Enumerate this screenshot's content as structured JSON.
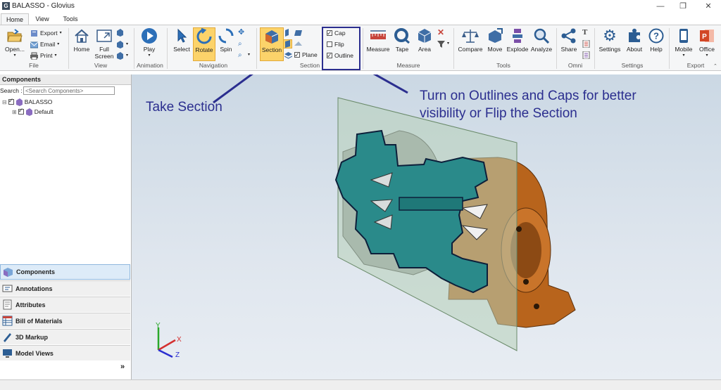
{
  "window": {
    "title": "BALASSO - Glovius",
    "app_icon_letter": "G"
  },
  "tabs": [
    {
      "label": "Home"
    },
    {
      "label": "View"
    },
    {
      "label": "Tools"
    }
  ],
  "ribbon": {
    "file": {
      "open": "Open...",
      "export": "Export",
      "email": "Email",
      "print": "Print",
      "group": "File"
    },
    "view": {
      "home": "Home",
      "fullscreen_1": "Full",
      "fullscreen_2": "Screen",
      "group": "View"
    },
    "animation": {
      "play": "Play",
      "group": "Animation"
    },
    "navigation": {
      "select": "Select",
      "rotate": "Rotate",
      "spin": "Spin",
      "group": "Navigation"
    },
    "section": {
      "section": "Section",
      "plane": "Plane",
      "group": "Section"
    },
    "options": {
      "cap": "Cap",
      "flip": "Flip",
      "outline": "Outline",
      "cap_checked": true,
      "flip_checked": false,
      "outline_checked": true
    },
    "measure": {
      "measure": "Measure",
      "tape": "Tape",
      "area": "Area",
      "group": "Measure"
    },
    "tools": {
      "compare": "Compare",
      "move": "Move",
      "explode": "Explode",
      "analyze": "Analyze",
      "group": "Tools"
    },
    "omni": {
      "share": "Share",
      "group": "Omni"
    },
    "settings": {
      "settings": "Settings",
      "about": "About",
      "help": "Help",
      "group": "Settings"
    },
    "export": {
      "mobile": "Mobile",
      "office": "Office",
      "group": "Export"
    }
  },
  "left_panel": {
    "header": "Components",
    "search_label": "Search :",
    "search_placeholder": "<Search Components>",
    "tree": [
      {
        "label": "BALASSO"
      },
      {
        "label": "Default"
      }
    ],
    "tabs": [
      {
        "label": "Components"
      },
      {
        "label": "Annotations"
      },
      {
        "label": "Attributes"
      },
      {
        "label": "Bill of Materials"
      },
      {
        "label": "3D Markup"
      },
      {
        "label": "Model Views"
      }
    ],
    "more": "»"
  },
  "annotations": {
    "take_section": "Take Section",
    "outline_line1": "Turn on Outlines and Caps for better",
    "outline_line2": "visibility or Flip the Section"
  },
  "axes": {
    "x": "X",
    "y": "Y",
    "z": "Z"
  },
  "colors": {
    "accent": "#2b2e8f",
    "highlight": "#fcd36a",
    "section_cap": "#2a8a8a",
    "body_orange": "#b8641c"
  }
}
